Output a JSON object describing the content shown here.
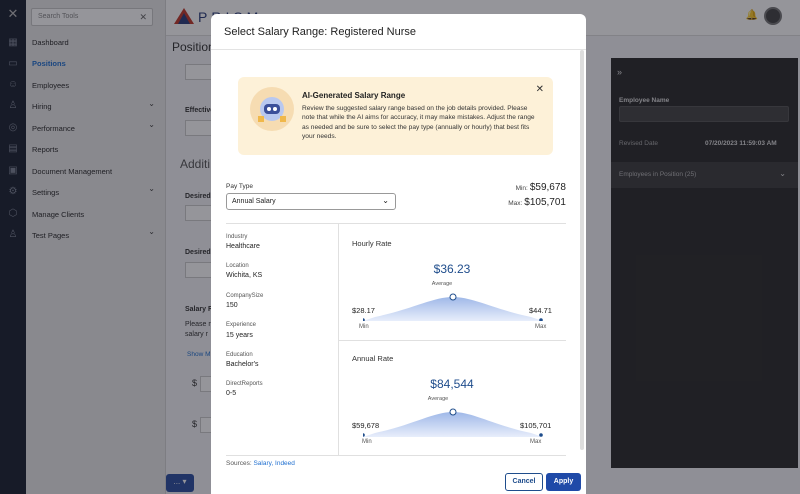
{
  "sidebar": {
    "search_placeholder": "Search Tools",
    "items": [
      {
        "label": "Dashboard"
      },
      {
        "label": "Positions"
      },
      {
        "label": "Employees"
      },
      {
        "label": "Hiring"
      },
      {
        "label": "Performance"
      },
      {
        "label": "Reports"
      },
      {
        "label": "Document Management"
      },
      {
        "label": "Settings"
      },
      {
        "label": "Manage Clients"
      },
      {
        "label": "Test Pages"
      }
    ]
  },
  "header": {
    "logo_text": "PRISM"
  },
  "background": {
    "page_title": "Position",
    "effective": "Effective",
    "additional": "Additi",
    "desired1": "Desired",
    "desired2": "Desired",
    "salary_head": "Salary R",
    "salary_note": "Please n salary r",
    "show_more": "Show M",
    "dollar": "$",
    "footer_btn": "... ▾"
  },
  "right_panel": {
    "collapse_icon": "»",
    "employee_name_label": "Employee Name",
    "revised_label": "Revised Date",
    "revised_value": "07/20/2023 11:59:03 AM",
    "employees_section": "Employees in Position (25)"
  },
  "modal": {
    "title": "Select Salary Range: Registered Nurse",
    "ai": {
      "title": "AI-Generated Salary Range",
      "body": "Review the suggested salary range based on the job details provided. Please note that while the AI aims for accuracy, it may make mistakes. Adjust the range as needed and be sure to select the pay type (annually or hourly) that best fits your needs."
    },
    "pay_type_label": "Pay Type",
    "pay_type_value": "Annual Salary",
    "min_label": "Min:",
    "min_value": "$59,678",
    "max_label": "Max:",
    "max_value": "$105,701",
    "details": [
      {
        "label": "Industry",
        "value": "Healthcare"
      },
      {
        "label": "Location",
        "value": "Wichita, KS"
      },
      {
        "label": "CompanySize",
        "value": "150"
      },
      {
        "label": "Experience",
        "value": "15 years"
      },
      {
        "label": "Education",
        "value": "Bachelor's"
      },
      {
        "label": "DirectReports",
        "value": "0-5"
      }
    ],
    "hourly": {
      "title": "Hourly Rate",
      "average": "$36.23",
      "average_label": "Average",
      "min": "$28.17",
      "min_label": "Min",
      "max": "$44.71",
      "max_label": "Max"
    },
    "annual": {
      "title": "Annual Rate",
      "average": "$84,544",
      "average_label": "Average",
      "min": "$59,678",
      "min_label": "Min",
      "max": "$105,701",
      "max_label": "Max"
    },
    "sources_label": "Sources:",
    "sources_value": "Salary, Indeed",
    "cancel_label": "Cancel",
    "apply_label": "Apply"
  },
  "colors": {
    "accent": "#1f4aa8",
    "ai_banner": "#fdf1d8",
    "sidebar_bg": "#e9e9e9",
    "rail_bg": "#1b2230"
  }
}
